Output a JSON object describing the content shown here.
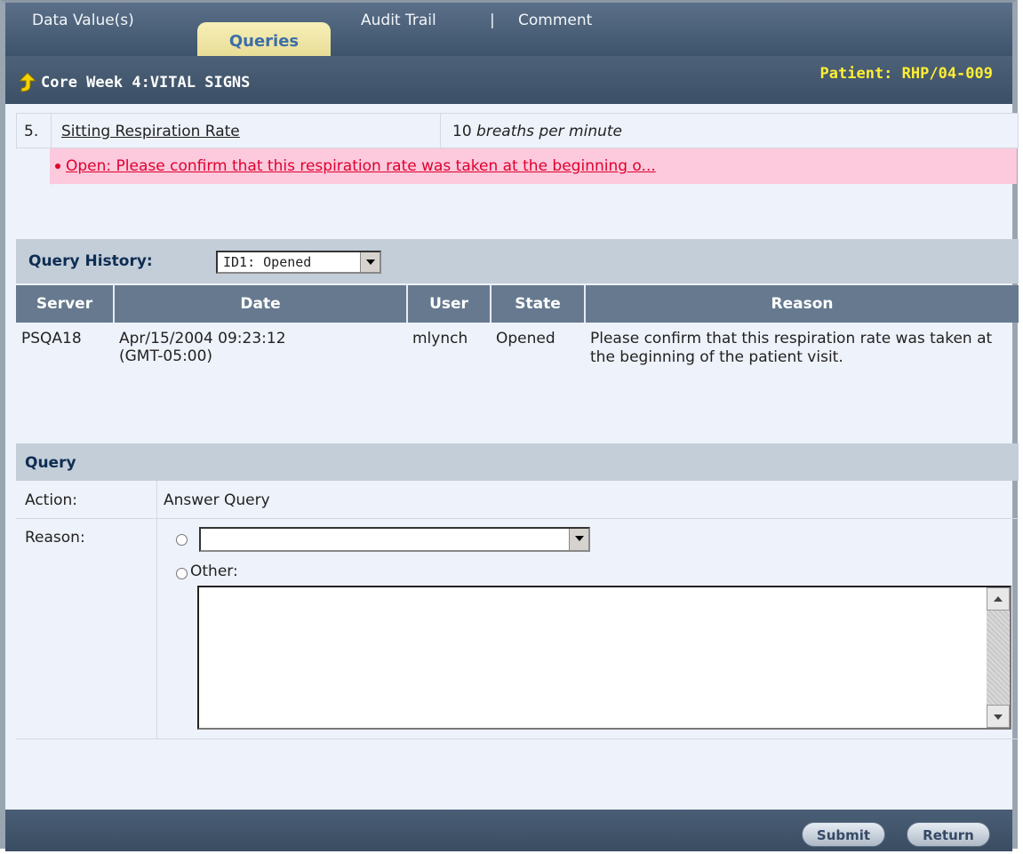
{
  "tabs": {
    "data_values": "Data Value(s)",
    "queries": "Queries",
    "audit_trail": "Audit Trail",
    "separator": "|",
    "comment": "Comment"
  },
  "header": {
    "title": "Core Week 4:VITAL SIGNS",
    "patient": "Patient: RHP/04-009"
  },
  "item": {
    "number": "5.",
    "label": "Sitting Respiration Rate",
    "value": "10",
    "unit": "breaths per minute",
    "query_text": "Open: Please confirm that this respiration rate was taken at the beginning o..."
  },
  "history": {
    "label": "Query History:",
    "selected": "ID1: Opened",
    "columns": [
      "Server",
      "Date",
      "User",
      "State",
      "Reason"
    ],
    "rows": [
      {
        "server": "PSQA18",
        "date": "Apr/15/2004 09:23:12",
        "tz": "(GMT-05:00)",
        "user": "mlynch",
        "state": "Opened",
        "reason": "Please confirm that this respiration rate was taken at the beginning of the patient visit."
      }
    ]
  },
  "query": {
    "section_title": "Query",
    "action_label": "Action:",
    "action_value": "Answer Query",
    "reason_label": "Reason:",
    "other_label": "Other:"
  },
  "footer": {
    "submit": "Submit",
    "return": "Return"
  }
}
